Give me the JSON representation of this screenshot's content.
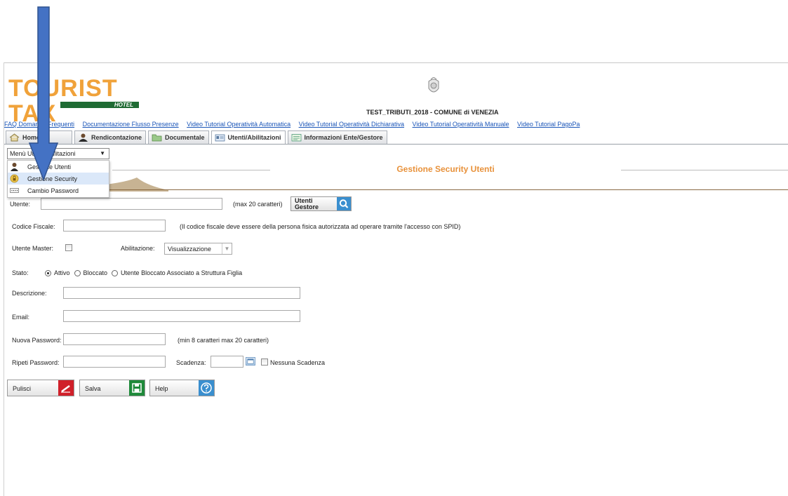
{
  "header": {
    "logo_text": "TOURIST TAX",
    "logo_sub": "HOTEL",
    "entity_title": "TEST_TRIBUTI_2018 - COMUNE di VENEZIA"
  },
  "links": [
    "FAQ Domande Frequenti",
    "Documentazione Flusso Presenze",
    "Video Tutorial Operatività Automatica",
    "Video Tutorial Operatività Dichiarativa",
    "Video Tutorial Operatività Manuale",
    "Video Tutorial PagoPa"
  ],
  "tabs": [
    {
      "label": "Home",
      "icon": "home-icon"
    },
    {
      "label": "Rendicontazione",
      "icon": "user-icon"
    },
    {
      "label": "Documentale",
      "icon": "folder-icon"
    },
    {
      "label": "Utenti/Abilitazioni",
      "icon": "id-card-icon"
    },
    {
      "label": "Informazioni Ente/Gestore",
      "icon": "form-icon"
    }
  ],
  "menu": {
    "selected": "Menù Utenti Abilitazioni",
    "items": [
      {
        "label": "Gestione Utenti",
        "icon": "user-icon"
      },
      {
        "label": "Gestione Security",
        "icon": "lock-icon"
      },
      {
        "label": "Cambio Password",
        "icon": "password-icon"
      }
    ]
  },
  "page_title": "Gestione Security Utenti",
  "form": {
    "utente_label": "Utente:",
    "utente_note": "(max 20 caratteri)",
    "utenti_gestore_line1": "Utenti",
    "utenti_gestore_line2": "Gestore",
    "cf_label": "Codice Fiscale:",
    "cf_note": "(Il codice fiscale deve essere della persona fisica autorizzata ad operare tramite l'accesso con SPID)",
    "master_label": "Utente Master:",
    "abilitazione_label": "Abilitazione:",
    "abilitazione_value": "Visualizzazione",
    "stato_label": "Stato:",
    "stato_options": [
      "Attivo",
      "Bloccato",
      "Utente Bloccato Associato a Struttura Figlia"
    ],
    "descrizione_label": "Descrizione:",
    "email_label": "Email:",
    "nuova_pw_label": "Nuova Password:",
    "nuova_pw_note": "(min 8 caratteri max 20 caratteri)",
    "ripeti_pw_label": "Ripeti Password:",
    "scadenza_label": "Scadenza:",
    "nessuna_scadenza": "Nessuna Scadenza"
  },
  "buttons": {
    "pulisci": "Pulisci",
    "salva": "Salva",
    "help": "Help"
  },
  "colors": {
    "accent_orange": "#e8913a",
    "link_blue": "#1a55b8",
    "arrow_blue": "#4472c4",
    "pulisci_red": "#d0202a",
    "salva_green": "#1f8a3a",
    "help_blue": "#3a8fcf"
  }
}
